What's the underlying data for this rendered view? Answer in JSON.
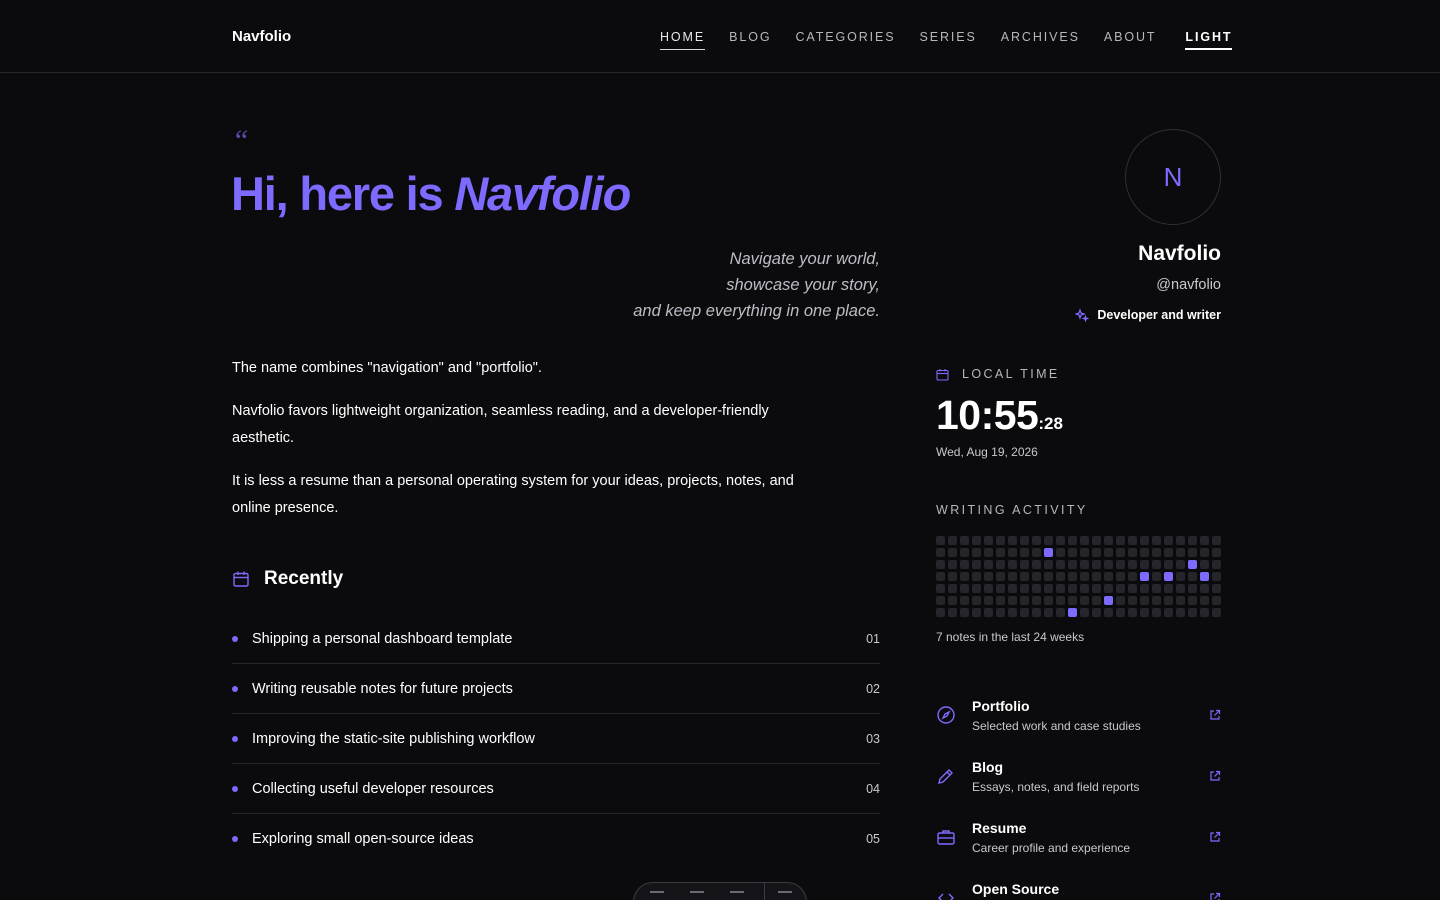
{
  "header": {
    "brand": "Navfolio",
    "nav": [
      "HOME",
      "BLOG",
      "CATEGORIES",
      "SERIES",
      "ARCHIVES",
      "ABOUT"
    ],
    "active_nav": "HOME",
    "theme_toggle": "LIGHT"
  },
  "hero": {
    "quote_mark": "“",
    "title_prefix": "Hi, here is ",
    "title_name": "Navfolio",
    "tagline": [
      "Navigate your world,",
      "showcase your story,",
      "and keep everything in one place."
    ]
  },
  "intro": [
    "The name combines \"navigation\" and \"portfolio\".",
    "Navfolio favors lightweight organization, seamless reading, and a developer-friendly aesthetic.",
    "It is less a resume than a personal operating system for your ideas, projects, notes, and online presence."
  ],
  "recently": {
    "heading": "Recently",
    "items": [
      {
        "title": "Shipping a personal dashboard template",
        "num": "01"
      },
      {
        "title": "Writing reusable notes for future projects",
        "num": "02"
      },
      {
        "title": "Improving the static-site publishing workflow",
        "num": "03"
      },
      {
        "title": "Collecting useful developer resources",
        "num": "04"
      },
      {
        "title": "Exploring small open-source ideas",
        "num": "05"
      }
    ]
  },
  "profile": {
    "avatar_letter": "N",
    "name": "Navfolio",
    "handle": "@navfolio",
    "bio": "Developer and writer"
  },
  "local_time": {
    "label": "LOCAL TIME",
    "hours_minutes": "10:55",
    "seconds": ":28",
    "date": "Wed, Aug 19, 2026"
  },
  "activity": {
    "label": "WRITING ACTIVITY",
    "weeks": 24,
    "days": 7,
    "active_cells": [
      [
        9,
        1
      ],
      [
        21,
        2
      ],
      [
        17,
        3
      ],
      [
        19,
        3
      ],
      [
        22,
        3
      ],
      [
        14,
        5
      ],
      [
        11,
        6
      ]
    ],
    "caption": "7 notes in the last 24 weeks"
  },
  "links": [
    {
      "title": "Portfolio",
      "desc": "Selected work and case studies",
      "icon": "compass-icon"
    },
    {
      "title": "Blog",
      "desc": "Essays, notes, and field reports",
      "icon": "pencil-icon"
    },
    {
      "title": "Resume",
      "desc": "Career profile and experience",
      "icon": "briefcase-icon"
    },
    {
      "title": "Open Source",
      "desc": "",
      "icon": "code-icon"
    }
  ],
  "colors": {
    "accent": "#7d6bff",
    "background": "#0b0b0e",
    "text": "#f2f2f4",
    "muted": "#c8c8cf"
  }
}
